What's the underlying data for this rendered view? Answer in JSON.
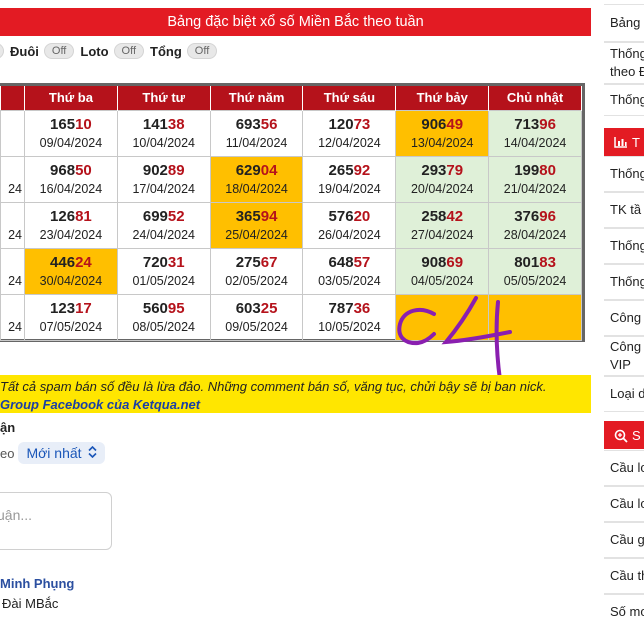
{
  "header": {
    "title": "Bảng đặc biệt xổ số Miền Bắc theo tuần"
  },
  "toggles": {
    "first_off": "f",
    "items": [
      {
        "label": "Đuôi",
        "state": "Off"
      },
      {
        "label": "Loto",
        "state": "Off"
      },
      {
        "label": "Tổng",
        "state": "Off"
      }
    ]
  },
  "table": {
    "columns": [
      "Thứ ba",
      "Thứ tư",
      "Thứ năm",
      "Thứ sáu",
      "Thứ bảy",
      "Chủ nhật"
    ],
    "rows": [
      {
        "cut_date": "",
        "cells": [
          {
            "head": "165",
            "tail": "10",
            "date": "09/04/2024",
            "bg": ""
          },
          {
            "head": "141",
            "tail": "38",
            "date": "10/04/2024",
            "bg": ""
          },
          {
            "head": "693",
            "tail": "56",
            "date": "11/04/2024",
            "bg": ""
          },
          {
            "head": "120",
            "tail": "73",
            "date": "12/04/2024",
            "bg": ""
          },
          {
            "head": "906",
            "tail": "49",
            "date": "13/04/2024",
            "bg": "orange"
          },
          {
            "head": "713",
            "tail": "96",
            "date": "14/04/2024",
            "bg": "green"
          }
        ]
      },
      {
        "cut_date": "24",
        "cells": [
          {
            "head": "968",
            "tail": "50",
            "date": "16/04/2024",
            "bg": ""
          },
          {
            "head": "902",
            "tail": "89",
            "date": "17/04/2024",
            "bg": ""
          },
          {
            "head": "629",
            "tail": "04",
            "date": "18/04/2024",
            "bg": "orange"
          },
          {
            "head": "265",
            "tail": "92",
            "date": "19/04/2024",
            "bg": ""
          },
          {
            "head": "293",
            "tail": "79",
            "date": "20/04/2024",
            "bg": "green"
          },
          {
            "head": "199",
            "tail": "80",
            "date": "21/04/2024",
            "bg": "green"
          }
        ]
      },
      {
        "cut_date": "24",
        "cells": [
          {
            "head": "126",
            "tail": "81",
            "date": "23/04/2024",
            "bg": ""
          },
          {
            "head": "699",
            "tail": "52",
            "date": "24/04/2024",
            "bg": ""
          },
          {
            "head": "365",
            "tail": "94",
            "date": "25/04/2024",
            "bg": "orange"
          },
          {
            "head": "576",
            "tail": "20",
            "date": "26/04/2024",
            "bg": ""
          },
          {
            "head": "258",
            "tail": "42",
            "date": "27/04/2024",
            "bg": "green"
          },
          {
            "head": "376",
            "tail": "96",
            "date": "28/04/2024",
            "bg": "green"
          }
        ]
      },
      {
        "cut_date": "24",
        "cells": [
          {
            "head": "446",
            "tail": "24",
            "date": "30/04/2024",
            "bg": "orange"
          },
          {
            "head": "720",
            "tail": "31",
            "date": "01/05/2024",
            "bg": ""
          },
          {
            "head": "275",
            "tail": "67",
            "date": "02/05/2024",
            "bg": ""
          },
          {
            "head": "648",
            "tail": "57",
            "date": "03/05/2024",
            "bg": ""
          },
          {
            "head": "908",
            "tail": "69",
            "date": "04/05/2024",
            "bg": "green"
          },
          {
            "head": "801",
            "tail": "83",
            "date": "05/05/2024",
            "bg": "green"
          }
        ]
      },
      {
        "cut_date": "24",
        "cells": [
          {
            "head": "123",
            "tail": "17",
            "date": "07/05/2024",
            "bg": ""
          },
          {
            "head": "560",
            "tail": "95",
            "date": "08/05/2024",
            "bg": ""
          },
          {
            "head": "603",
            "tail": "25",
            "date": "09/05/2024",
            "bg": ""
          },
          {
            "head": "787",
            "tail": "36",
            "date": "10/05/2024",
            "bg": ""
          },
          {
            "head": "",
            "tail": "",
            "date": "",
            "bg": "orange"
          },
          {
            "head": "",
            "tail": "",
            "date": "",
            "bg": "orange"
          }
        ]
      }
    ]
  },
  "notice": {
    "line1": "Tất cả spam bán số đều là lừa đảo. Những comment bán số, văng tục, chửi bậy sẽ bị ban nick.",
    "line2": "Group Facebook của Ketqua.net"
  },
  "comments": {
    "label": "ận",
    "sort_prefix": "eo",
    "sort_value": "Mới nhất",
    "input_placeholder": "uận...",
    "user_name": "Minh Phụng",
    "user_sub": "Đài MBắc"
  },
  "sidebar": {
    "items": [
      "Bảng đ",
      "Thống",
      "theo Đ",
      "Thống"
    ],
    "head1": "T",
    "items2": [
      "Thống",
      "TK tầ",
      "Thống",
      "Thống",
      "Công c",
      "Công",
      "VIP",
      "Loại d"
    ],
    "head2": "S",
    "items3": [
      "Cầu lo",
      "Cầu lo",
      "Cầu g",
      "Cầu th",
      "Số mơ"
    ]
  },
  "annotation": {
    "text": "C4"
  },
  "colors": {
    "brand_red": "#e31b23",
    "header_dark_red": "#b5121b",
    "highlight_orange": "#ffbf00",
    "highlight_green": "#dff0d8",
    "notice_yellow": "#ffe600",
    "link_blue": "#1a56b8"
  }
}
